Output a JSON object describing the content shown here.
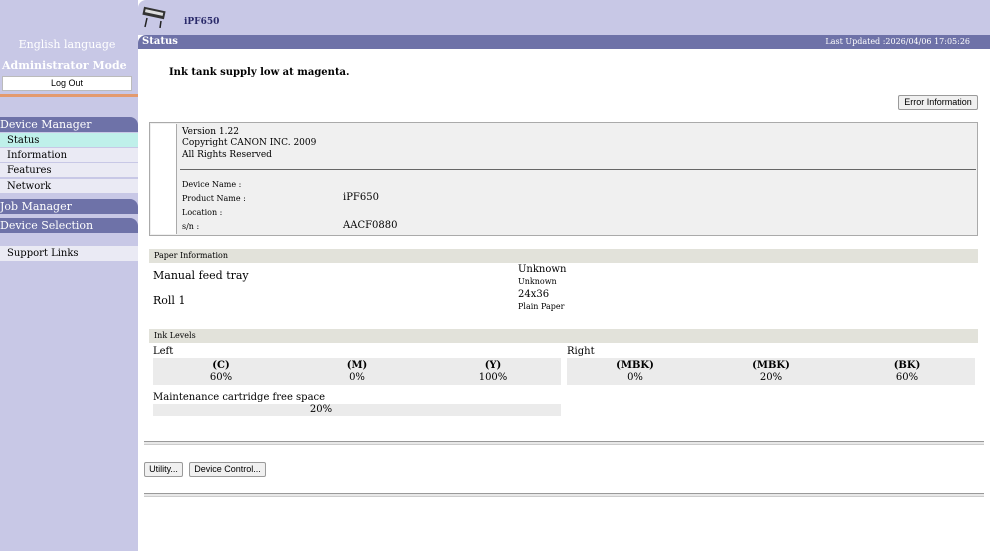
{
  "sidebar": {
    "language": "English language",
    "admin_mode": "Administrator Mode",
    "logout_label": "Log Out",
    "device_manager": "Device Manager",
    "items": [
      {
        "label": "Status"
      },
      {
        "label": "Information"
      },
      {
        "label": "Features"
      },
      {
        "label": "Network"
      }
    ],
    "job_manager": "Job Manager",
    "device_selection": "Device Selection",
    "support_links": "Support Links"
  },
  "header": {
    "model": "iPF650",
    "page_title": "Status",
    "last_updated": "Last Updated :2026/04/06 17:05:26"
  },
  "main": {
    "alert": "Ink tank supply low at magenta.",
    "error_info_button": "Error Information",
    "info": {
      "version": "Version 1.22",
      "copyright": "Copyright CANON INC. 2009",
      "rights": "All Rights Reserved",
      "device_name_label": "Device Name :",
      "device_name_value": "",
      "product_name_label": "Product Name :",
      "product_name_value": "iPF650",
      "location_label": "Location :",
      "location_value": "",
      "sn_label": "s/n :",
      "sn_value": "AACF0880"
    },
    "paper": {
      "header": "Paper Information",
      "rows": [
        {
          "source": "Manual feed tray",
          "size": "Unknown",
          "type": "Unknown"
        },
        {
          "source": "Roll 1",
          "size": "24x36",
          "type": "Plain Paper"
        }
      ]
    },
    "ink": {
      "header": "Ink Levels",
      "left_label": "Left",
      "right_label": "Right",
      "left": [
        {
          "name": "(C)",
          "level": "60%"
        },
        {
          "name": "(M)",
          "level": "0%"
        },
        {
          "name": "(Y)",
          "level": "100%"
        }
      ],
      "right": [
        {
          "name": "(MBK)",
          "level": "0%"
        },
        {
          "name": "(MBK)",
          "level": "20%"
        },
        {
          "name": "(BK)",
          "level": "60%"
        }
      ],
      "maintenance_label": "Maintenance cartridge free space",
      "maintenance_value": "20%"
    },
    "utility_button": "Utility...",
    "device_control_button": "Device Control..."
  },
  "colors": {
    "sidebar_bg": "#c8c8e6",
    "header_bar": "#6e72a8",
    "active_item": "#bff0ea",
    "accent_line": "#e39a6e"
  }
}
